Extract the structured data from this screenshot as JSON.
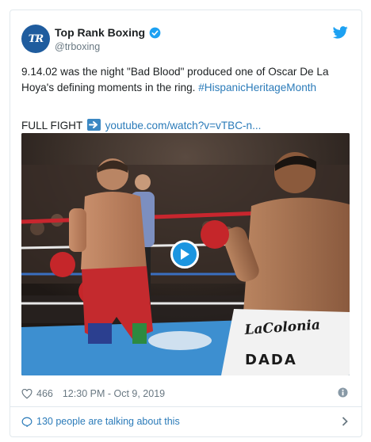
{
  "account": {
    "display_name": "Top Rank Boxing",
    "handle": "@trboxing",
    "avatar_initials": "TR",
    "avatar_color": "#1f5c9e"
  },
  "tweet": {
    "text_main": "9.14.02 was the night \"Bad Blood\" produced one of Oscar De La Hoya's defining moments in the ring.",
    "hashtag": "#HispanicHeritageMonth",
    "full_fight_label": "FULL FIGHT",
    "link_text": "youtube.com/watch?v=vTBC-n..."
  },
  "media": {
    "trunks_text_1": "LaColonia",
    "trunks_text_2": "DADA"
  },
  "meta": {
    "likes": "466",
    "timestamp": "12:30 PM - Oct 9, 2019"
  },
  "footer": {
    "talking_label": "130 people are talking about this"
  },
  "colors": {
    "link": "#2b7bb9",
    "twitter_blue": "#1da1f2",
    "play_button": "#1b95e0"
  },
  "icons": [
    "verified-icon",
    "twitter-bird-icon",
    "arrow-right-icon",
    "play-icon",
    "heart-icon",
    "info-icon",
    "speech-bubble-icon",
    "chevron-right-icon"
  ]
}
